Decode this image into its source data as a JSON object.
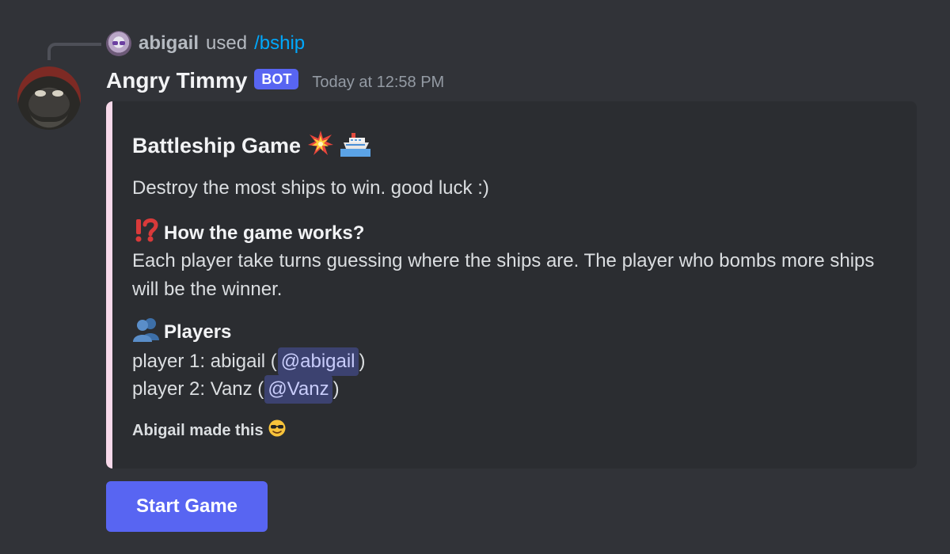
{
  "reply": {
    "username": "abigail",
    "action_text": "used",
    "command": "/bship"
  },
  "message": {
    "author": "Angry Timmy",
    "bot_tag": "BOT",
    "timestamp": "Today at 12:58 PM"
  },
  "embed": {
    "accent_color": "#f7d9ea",
    "title": "Battleship Game",
    "title_icons": [
      "collision-icon",
      "ship-icon"
    ],
    "description": "Destroy the most ships to win. good luck :)",
    "fields": [
      {
        "name": "How the game works?",
        "icon": "interrobang-icon",
        "value": "Each player take turns guessing where the ships are. The player who bombs more ships will be the winner."
      },
      {
        "name": "Players",
        "icon": "busts-in-silhouette-icon",
        "players": [
          {
            "prefix": "player 1: abigail (",
            "mention": "@abigail",
            "suffix": ")"
          },
          {
            "prefix": "player 2: Vanz (",
            "mention": "@Vanz",
            "suffix": ")"
          }
        ]
      }
    ],
    "footer": "Abigail made this",
    "footer_icon": "sunglasses-face-icon"
  },
  "components": {
    "start_button_label": "Start Game"
  },
  "colors": {
    "background": "#313338",
    "embed_background": "#2b2d31",
    "button": "#5865f2",
    "mention_background": "#3c4270",
    "command_link": "#00a8fc"
  }
}
